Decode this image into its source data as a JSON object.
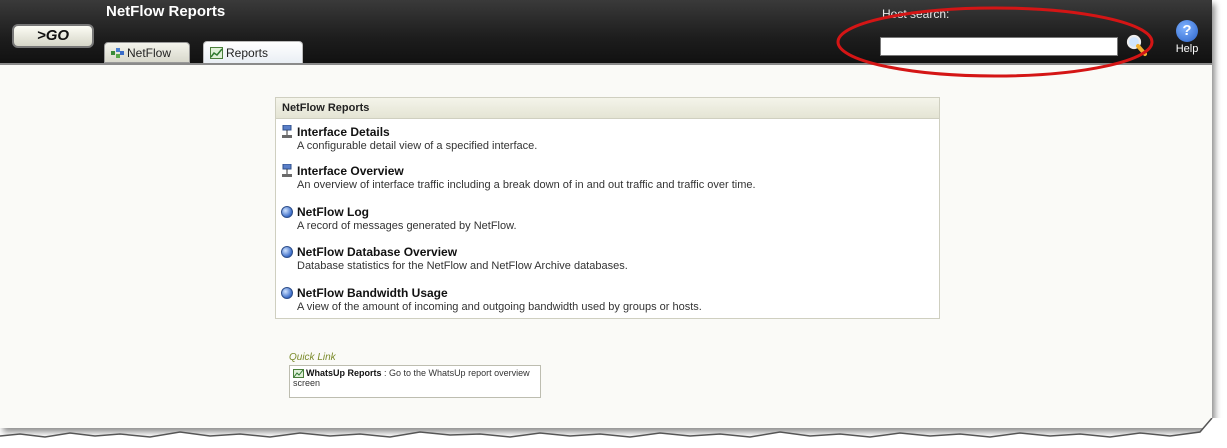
{
  "header": {
    "go_label": ">GO",
    "app_title": "NetFlow Reports",
    "tabs": [
      {
        "label": "NetFlow"
      },
      {
        "label": "Reports"
      }
    ],
    "host_search_label": "Host search:",
    "host_search_value": "",
    "help_label": "Help"
  },
  "panel": {
    "title": "NetFlow Reports",
    "reports": [
      {
        "title": "Interface Details",
        "desc": "A configurable detail view of a specified interface.",
        "icon": "network-icon"
      },
      {
        "title": "Interface Overview",
        "desc": "An overview of interface traffic including a break down of in and out traffic and traffic over time.",
        "icon": "network-icon"
      },
      {
        "title": "NetFlow Log",
        "desc": "A record of messages generated by NetFlow.",
        "icon": "globe-icon"
      },
      {
        "title": "NetFlow Database Overview",
        "desc": "Database statistics for the NetFlow and NetFlow Archive databases.",
        "icon": "globe-icon"
      },
      {
        "title": "NetFlow Bandwidth Usage",
        "desc": "A view of the amount of incoming and outgoing bandwidth used by groups or hosts.",
        "icon": "globe-icon"
      }
    ]
  },
  "quick_link": {
    "title": "Quick Link",
    "link_label": "WhatsUp Reports",
    "link_desc": ": Go to the WhatsUp report overview screen"
  },
  "colors": {
    "header_bg": "#1d1d1d",
    "annotation_red": "#d41515",
    "quick_link_title": "#7a8a2a"
  }
}
